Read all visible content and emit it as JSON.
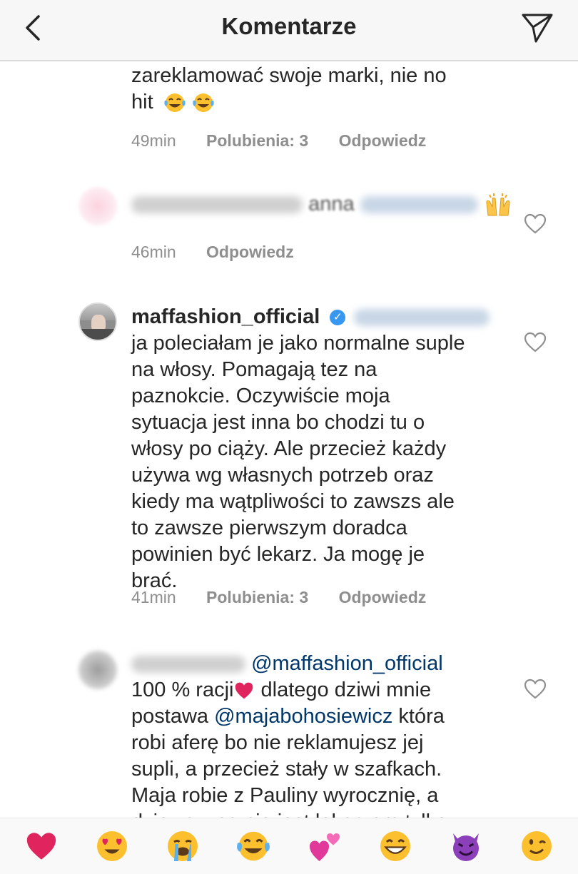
{
  "header": {
    "title": "Komentarze",
    "back_icon": "chevron-left-icon",
    "send_icon": "paper-plane-icon"
  },
  "comments": [
    {
      "text_line1": "zareklamować swoje marki, nie no",
      "text_line2": "hit",
      "emojis": [
        "face-with-tears-of-joy",
        "face-with-tears-of-joy"
      ],
      "time": "49min",
      "likes": "Polubienia: 3",
      "reply": "Odpowiedz"
    },
    {
      "visible_text": "anna",
      "emoji": "raising-hands",
      "time": "46min",
      "reply": "Odpowiedz"
    },
    {
      "username": "maffashion_official",
      "lines": [
        "ja poleciałam je jako normalne suple",
        "na włosy. Pomagają tez na",
        "paznokcie. Oczywiście moja",
        "sytuacja jest inna bo chodzi tu o",
        "włosy po ciąży. Ale przecież każdy",
        "używa wg własnych potrzeb oraz",
        "kiedy ma wątpliwości to zawszs ale",
        "to zawsze pierwszym doradca",
        "powinien być lekarz. Ja mogę je",
        "brać."
      ],
      "time": "41min",
      "likes": "Polubienia: 3",
      "reply": "Odpowiedz"
    },
    {
      "mention": "@maffashion_official",
      "line1_a": "100 % racji",
      "line1_b": " dlatego dziwi mnie",
      "line2_a": "postawa ",
      "line2_mention": "@majabohosiewicz",
      "line2_b": "  która",
      "line3": "robi aferę bo nie reklamujesz jej",
      "line4": "supli, a przecież stały w szafkach.",
      "line5": "Maja robie z Pauliny wyrocznię, a",
      "line6": "dziewczyna nie jest lekarzem tylko"
    }
  ],
  "emoji_bar": [
    "red-heart",
    "heart-eyes",
    "loudly-crying",
    "tears-of-joy",
    "two-hearts",
    "grinning",
    "smiling-devil",
    "winking"
  ],
  "colors": {
    "text": "#262626",
    "meta": "#8e8e8e",
    "mention": "#00376b",
    "verified": "#3897f0",
    "heart_red": "#e0245e"
  }
}
